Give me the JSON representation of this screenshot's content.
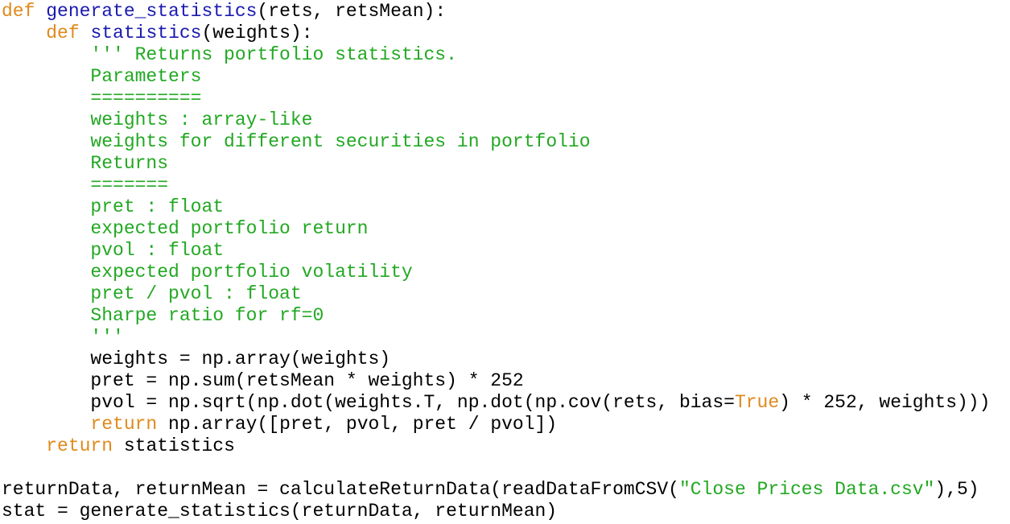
{
  "code": {
    "l1": {
      "kw": "def",
      "fn": "generate_statistics",
      "rest": "(rets, retsMean):"
    },
    "l2": {
      "indent": "    ",
      "kw": "def",
      "fn": "statistics",
      "rest": "(weights):"
    },
    "l3": {
      "indent": "        ",
      "text": "''' Returns portfolio statistics."
    },
    "l4": {
      "indent": "        ",
      "text": "Parameters"
    },
    "l5": {
      "indent": "        ",
      "text": "=========="
    },
    "l6": {
      "indent": "        ",
      "text": "weights : array-like"
    },
    "l7": {
      "indent": "        ",
      "text": "weights for different securities in portfolio"
    },
    "l8": {
      "indent": "        ",
      "text": "Returns"
    },
    "l9": {
      "indent": "        ",
      "text": "======="
    },
    "l10": {
      "indent": "        ",
      "text": "pret : float"
    },
    "l11": {
      "indent": "        ",
      "text": "expected portfolio return"
    },
    "l12": {
      "indent": "        ",
      "text": "pvol : float"
    },
    "l13": {
      "indent": "        ",
      "text": "expected portfolio volatility"
    },
    "l14": {
      "indent": "        ",
      "text": "pret / pvol : float"
    },
    "l15": {
      "indent": "        ",
      "text": "Sharpe ratio for rf=0"
    },
    "l16": {
      "indent": "        ",
      "text": "'''"
    },
    "l17": {
      "indent": "        ",
      "text": "weights = np.array(weights)"
    },
    "l18": {
      "indent": "        ",
      "text": "pret = np.sum(retsMean * weights) * 252"
    },
    "l19": {
      "indent": "        ",
      "pre": "pvol = np.sqrt(np.dot(weights.T, np.dot(np.cov(rets, bias=",
      "kw": "True",
      "post": ") * 252, weights)))"
    },
    "l20": {
      "indent": "        ",
      "kw": "return",
      "rest": " np.array([pret, pvol, pret / pvol])"
    },
    "l21": {
      "indent": "    ",
      "kw": "return",
      "rest": " statistics"
    },
    "l22": {
      "text": ""
    },
    "l23": {
      "pre": "returnData, returnMean = calculateReturnData(readDataFromCSV(",
      "str": "\"Close Prices Data.csv\"",
      "post": "),5)"
    },
    "l24": {
      "text": "stat = generate_statistics(returnData, returnMean)"
    }
  },
  "colors": {
    "keyword": "#e08a1c",
    "function_name": "#1a1ab0",
    "string": "#22a822",
    "plain": "#000000",
    "background": "#ffffff"
  }
}
